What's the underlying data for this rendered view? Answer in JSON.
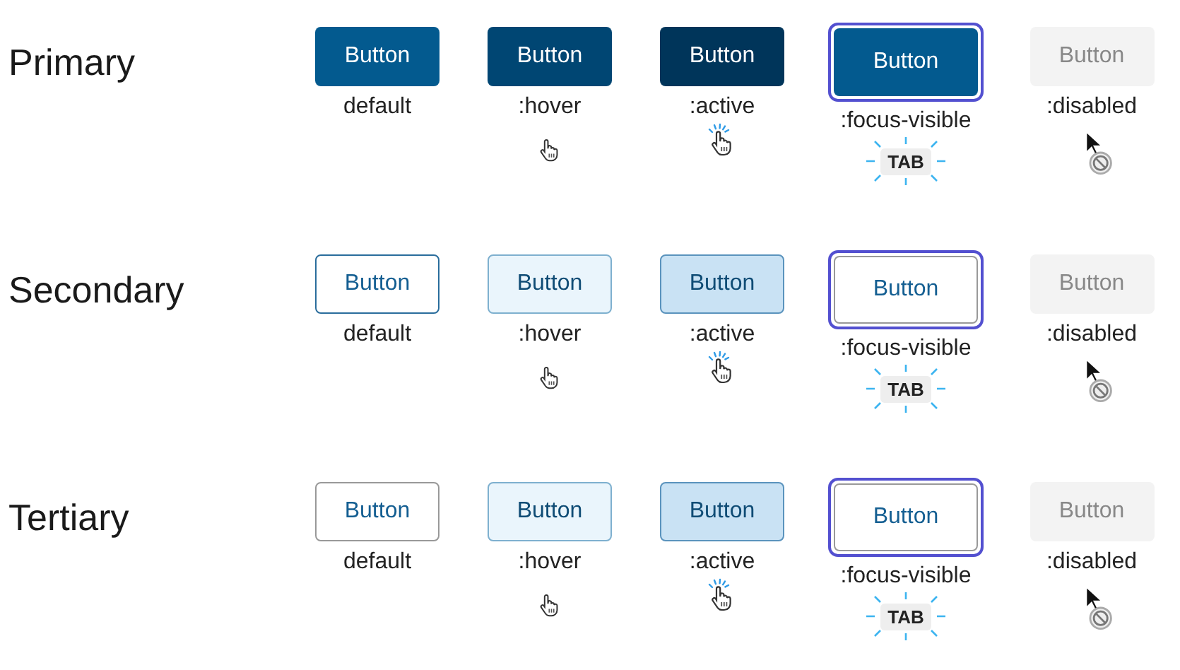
{
  "rows": [
    {
      "title": "Primary",
      "kind": "primary",
      "states": [
        {
          "kind": "default",
          "button": "Button",
          "label": "default"
        },
        {
          "kind": "hover",
          "button": "Button",
          "label": ":hover"
        },
        {
          "kind": "active",
          "button": "Button",
          "label": ":active"
        },
        {
          "kind": "focus",
          "button": "Button",
          "label": ":focus-visible",
          "key": "TAB"
        },
        {
          "kind": "disabled",
          "button": "Button",
          "label": ":disabled"
        }
      ]
    },
    {
      "title": "Secondary",
      "kind": "secondary",
      "states": [
        {
          "kind": "default",
          "button": "Button",
          "label": "default"
        },
        {
          "kind": "hover",
          "button": "Button",
          "label": ":hover"
        },
        {
          "kind": "active",
          "button": "Button",
          "label": ":active"
        },
        {
          "kind": "focus",
          "button": "Button",
          "label": ":focus-visible",
          "key": "TAB"
        },
        {
          "kind": "disabled",
          "button": "Button",
          "label": ":disabled"
        }
      ]
    },
    {
      "title": "Tertiary",
      "kind": "tertiary",
      "states": [
        {
          "kind": "default",
          "button": "Button",
          "label": "default"
        },
        {
          "kind": "hover",
          "button": "Button",
          "label": ":hover"
        },
        {
          "kind": "active",
          "button": "Button",
          "label": ":active"
        },
        {
          "kind": "focus",
          "button": "Button",
          "label": ":focus-visible",
          "key": "TAB"
        },
        {
          "kind": "disabled",
          "button": "Button",
          "label": ":disabled"
        }
      ]
    }
  ]
}
